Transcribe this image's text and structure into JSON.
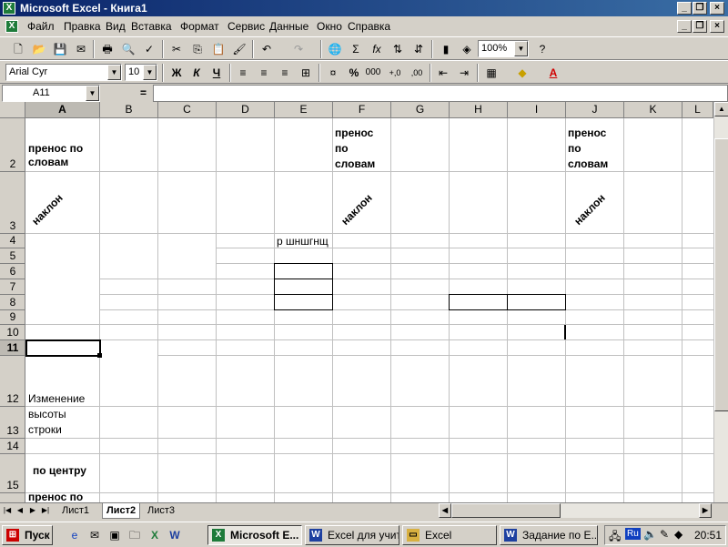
{
  "window": {
    "title": "Microsoft Excel - Книга1"
  },
  "menu": [
    "Файл",
    "Правка",
    "Вид",
    "Вставка",
    "Формат",
    "Сервис",
    "Данные",
    "Окно",
    "Справка"
  ],
  "toolbar": {
    "zoom": "100%",
    "font_name": "Arial Cyr",
    "font_size": "10",
    "bold": "Ж",
    "italic": "К",
    "underline": "Ч",
    "percent": "%",
    "thousands": "000",
    "inc_decimal": "+,0",
    "dec_decimal": ",00",
    "sum": "Σ",
    "fx": "fx"
  },
  "formula": {
    "name_box": "A11",
    "equals": "=",
    "value": ""
  },
  "columns": [
    "A",
    "B",
    "C",
    "D",
    "E",
    "F",
    "G",
    "H",
    "I",
    "J",
    "K",
    "L"
  ],
  "rows": [
    "2",
    "3",
    "4",
    "5",
    "6",
    "7",
    "8",
    "9",
    "10",
    "11",
    "12",
    "13",
    "14",
    "15",
    ""
  ],
  "cells": {
    "a2": "пренос по словам",
    "f2": "пренос по словам",
    "j2": "пренос по словам",
    "a3": "наклон",
    "f3": "наклон",
    "j3": "наклон",
    "e4": "р шншгнщ",
    "a12": "Изменение",
    "a13_1": "высоты",
    "a13_2": "строки",
    "a15": "по центру",
    "a16": "пренос по"
  },
  "sheets": [
    "Лист1",
    "Лист2",
    "Лист3"
  ],
  "taskbar": {
    "start": "Пуск",
    "tasks": [
      "Microsoft E...",
      "Excel для учит...",
      "Excel",
      "Задание по Е..."
    ],
    "lang": "Ru",
    "clock": "20:51"
  }
}
